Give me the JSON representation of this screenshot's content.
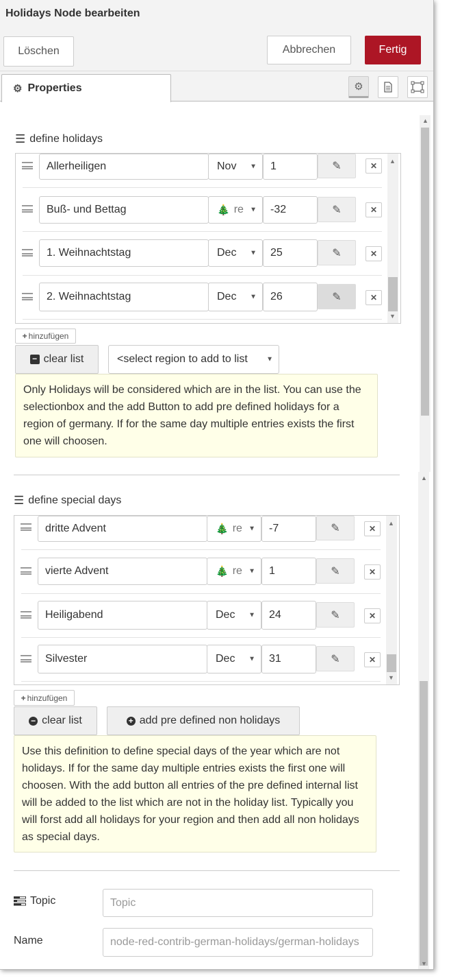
{
  "header": {
    "title": "Holidays Node bearbeiten",
    "delete_label": "Löschen",
    "cancel_label": "Abbrechen",
    "done_label": "Fertig"
  },
  "tabs": {
    "properties_label": "Properties"
  },
  "holidays": {
    "label": "define holidays",
    "rows": [
      {
        "name": "Allerheiligen",
        "month": "Nov",
        "day": "1"
      },
      {
        "name": "Buß- und Bettag",
        "month": "re",
        "day": "-32",
        "month_icon": "tree-icon"
      },
      {
        "name": "1. Weihnachtstag",
        "month": "Dec",
        "day": "25"
      },
      {
        "name": "2. Weihnachtstag",
        "month": "Dec",
        "day": "26"
      }
    ],
    "add_label": "hinzufügen",
    "clear_label": "clear list",
    "region_select": "<select region to add to list",
    "info": "Only Holidays will be considered which are in the list. You can use the selectionbox and the add Button to add pre defined holidays for a region of germany. If for the same day multiple entries exists the first one will choosen."
  },
  "special_days": {
    "label": "define special days",
    "rows": [
      {
        "name": "dritte Advent",
        "month": "re",
        "day": "-7",
        "month_icon": "tree-icon"
      },
      {
        "name": "vierte Advent",
        "month": "re",
        "day": "1",
        "month_icon": "tree-icon"
      },
      {
        "name": "Heiligabend",
        "month": "Dec",
        "day": "24"
      },
      {
        "name": "Silvester",
        "month": "Dec",
        "day": "31"
      }
    ],
    "add_label": "hinzufügen",
    "clear_label": "clear list",
    "add_predefined_label": "add pre defined non holidays",
    "info": "Use this definition to define special days of the year which are not holidays. If for the same day multiple entries exists the first one will choosen. With the add button all entries of the pre defined internal list will be added to the list which are not in the holiday list. Typically you will forst add all holidays for your region and then add all non holidays as special days."
  },
  "topic": {
    "label": "Topic",
    "placeholder": "Topic",
    "value": ""
  },
  "name": {
    "label": "Name",
    "placeholder": "node-red-contrib-german-holidays/german-holidays",
    "value": ""
  },
  "colors": {
    "accent": "#ad1625",
    "info_bg": "#ffffe8"
  }
}
